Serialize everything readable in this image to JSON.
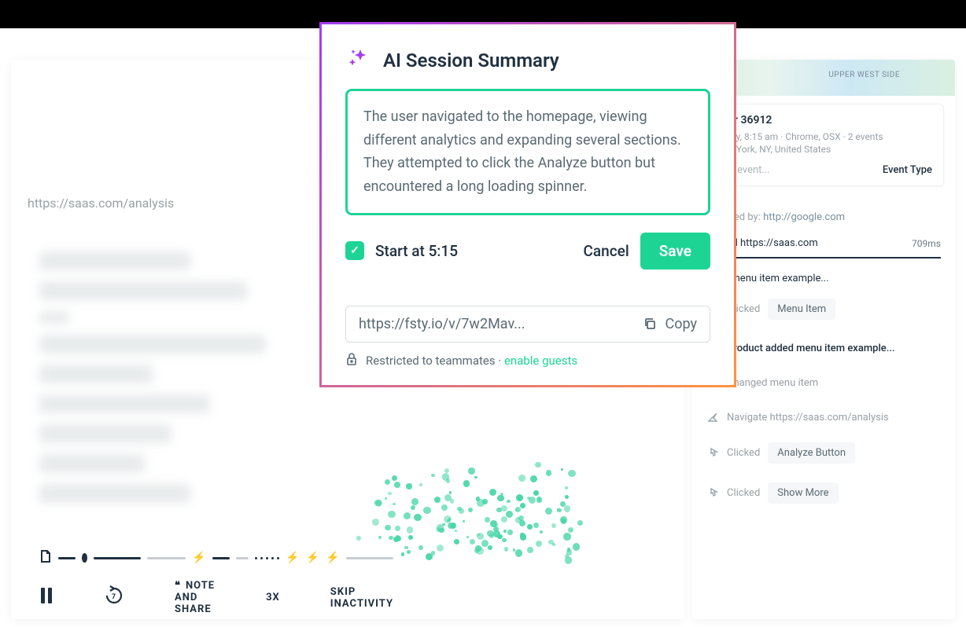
{
  "bg": {
    "url": "https://saas.com/analysis"
  },
  "playback": {
    "note_share": "NOTE AND SHARE",
    "speed": "3X",
    "skip": "SKIP INACTIVITY"
  },
  "map": {
    "label": "UPPER\nWEST SIDE"
  },
  "user": {
    "title": "User 36912",
    "meta": "Today, 8:15 am · Chrome, OSX · 2 events",
    "location": "New York, NY, United States",
    "search_placeholder": "Find event...",
    "event_type": "Event Type"
  },
  "events": {
    "referred_label": "Referred by: ",
    "referred_url": "http://google.com",
    "visited": "Visited https://saas.com",
    "visited_ms": "709ms",
    "clicked": "Clicked",
    "menu_item_desc": "Click menu item example...",
    "menu_item": "Menu Item",
    "product_added": "Product added menu item example...",
    "changed": "Changed menu item",
    "navigate": "Navigate https://saas.com/analysis",
    "analyze_btn": "Analyze Button",
    "show_more": "Show More"
  },
  "modal": {
    "title": "AI Session Summary",
    "summary": "The user navigated to the homepage, viewing different analytics and expanding several sections. They attempted to click the Analyze button but encountered a long loading spinner.",
    "start_at": "Start at 5:15",
    "cancel": "Cancel",
    "save": "Save",
    "share_url": "https://fsty.io/v/7w2Mav...",
    "copy": "Copy",
    "restricted": "Restricted to teammates · ",
    "enable_guests": "enable guests"
  }
}
